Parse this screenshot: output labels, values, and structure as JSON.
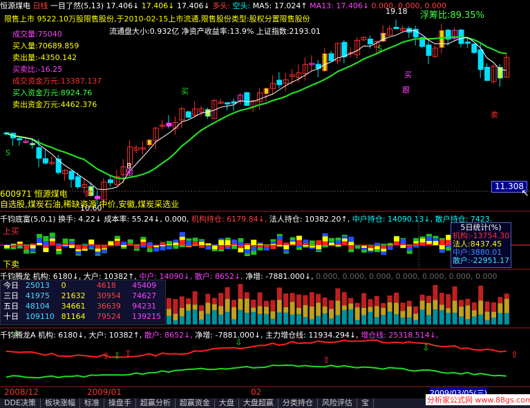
{
  "header": {
    "stock_name": "恒源煤电",
    "period": "日线",
    "indicator": "一目了然(5,13)",
    "v1": "17.406↓",
    "v2": "17.406↓",
    "v3": "17.406↓",
    "duokong_label": "多头:",
    "duokong_val": "空头:",
    "ma5": "MA5: 17.024↑",
    "ma13": "MA13: 17.406↓",
    "z1": "0.000,",
    "z2": "0.000,",
    "z3": "0.000"
  },
  "main": {
    "float_ratio": "浮筹比:89.35%",
    "high_label": "19.18",
    "low_label": "10.60",
    "info_line1": "限售上市  9522.10万股限售股份,于2010-02-15上市流通,限售股份类型:股权分置限售股份",
    "info_line2": "流通盘大小:0.932亿  净资产收益率:13.9%  上证指数:2193.01",
    "stats": [
      {
        "label": "成交量:",
        "value": "75040",
        "color": "#ff40ff"
      },
      {
        "label": "买入量:",
        "value": "70689.859",
        "color": "#ffff00"
      },
      {
        "label": "卖出量:",
        "value": "-4350.142",
        "color": "#ffff00"
      },
      {
        "label": "买卖比:",
        "value": "-16.25",
        "color": "#ff40ff"
      },
      {
        "label": "成交资金万元:",
        "value": "13387.137",
        "color": "#ff3030"
      },
      {
        "label": "买入资金万元:",
        "value": "8924.76",
        "color": "#40ff40"
      },
      {
        "label": "卖出资金万元:",
        "value": "4462.376",
        "color": "#ffff00"
      }
    ],
    "markers": {
      "buy": "买",
      "follow": "跟",
      "sell": "卖",
      "s": "S",
      "b": "B"
    },
    "stock_code_line": "600971 恒源煤电",
    "tags_line": "自选股,煤炭石油,稀缺资源,中价,安徽,煤炭采选业",
    "current_price": "11.308"
  },
  "panel1": {
    "title": "千钧底富(5,0,1)",
    "turnover": "换手: 4.22↓",
    "cost": "成本率: 55.24↓, 0.000,",
    "inst": "机构持仓: 6179.84↓,",
    "corp": "法人持仓: 10382.20↑,",
    "mid": "中户持仓: 14090.13↓,",
    "retail": "散户持仓: 7423.",
    "up_label": "上买",
    "down_label": "下卖",
    "box_title": "5日统计(%)",
    "box_rows": [
      {
        "label": "机构:",
        "value": "-13754.30",
        "color": "#ff3030"
      },
      {
        "label": "法人:",
        "value": "8437.45",
        "color": "#ffff00"
      },
      {
        "label": "中户:",
        "value": "3880.01",
        "color": "#4090ff"
      },
      {
        "label": "散户:",
        "value": "-22951.17",
        "color": "#40e0ff"
      }
    ]
  },
  "panel2": {
    "title": "千钧腾龙",
    "inst": "机构: 6180↓,",
    "big": "大户: 10382↑,",
    "mid": "中户: 14090↓,",
    "retail": "散户: 8652↓,",
    "net": "净增: -7881.000↓,",
    "zeros": "0.000, 0.000, 0.000, 0.000, 0.000, 0.000, 0.000",
    "table": [
      {
        "label": "今日",
        "c1": "25013",
        "c2": "0",
        "c3": "4618",
        "c4": "45409"
      },
      {
        "label": "三日",
        "c1": "41975",
        "c2": "21632",
        "c3": "30954",
        "c4": "74627"
      },
      {
        "label": "五日",
        "c1": "48104",
        "c2": "34661",
        "c3": "36639",
        "c4": "94231"
      },
      {
        "label": "十日",
        "c1": "109110",
        "c2": "81164",
        "c3": "79524",
        "c4": "139215"
      }
    ]
  },
  "panel3": {
    "title": "千钧腾龙A",
    "inst": "机构: 6180↓,",
    "big": "大户: 10382↑,",
    "retail": "散户: 8652↓,",
    "net": "净增: -7881.000↓,",
    "main_force": "主力增仓线: 11934.294↓,",
    "increase": "增仓线: 25318.514↓,"
  },
  "axis": {
    "d1": "2008/12",
    "d2": "2009/01",
    "d3": "02",
    "d4": "2009/03/05(三)"
  },
  "tabs": [
    "DDE决策",
    "板块涨幅",
    "标准",
    "操盘手",
    "超赢分析",
    "超赢资金",
    "大盘",
    "大盘超赢",
    "分类持仓",
    "风险评估",
    "宝"
  ],
  "watermark": "分析家公式网 www.88gs.com",
  "colors": {
    "up": "#ff3030",
    "down": "#00e0ff",
    "ma_green": "#22dd22",
    "ma_white": "#ffffff",
    "magenta": "#ff40ff",
    "yellow": "#ffff00",
    "blue": "#2060ff"
  }
}
